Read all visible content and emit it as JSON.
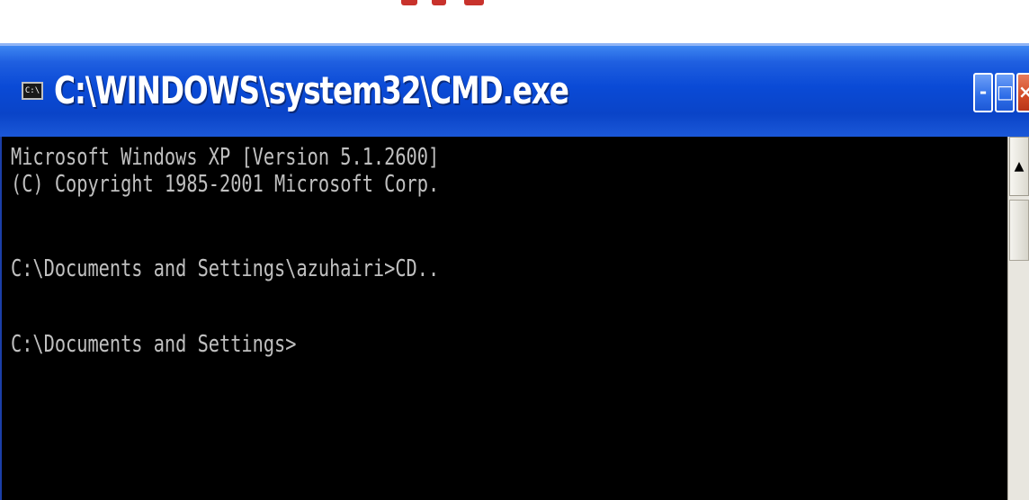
{
  "window": {
    "title": "C:\\WINDOWS\\system32\\CMD.exe",
    "icon": "cmd-app-icon",
    "icon_glyph": "C:\\",
    "buttons": {
      "minimize_glyph": "-",
      "maximize_glyph": "□",
      "close_glyph": "×"
    },
    "colors": {
      "titlebar": "#0a4ad6",
      "console_bg": "#000000",
      "console_text": "#c0c0c0",
      "close_button": "#d24a24"
    }
  },
  "console": {
    "lines": [
      "Microsoft Windows XP [Version 5.1.2600]",
      "(C) Copyright 1985-2001 Microsoft Corp.",
      "",
      "C:\\Documents and Settings\\azuhairi>CD..",
      "",
      "C:\\Documents and Settings>"
    ]
  },
  "scrollbar": {
    "up_arrow_glyph": "▲"
  }
}
